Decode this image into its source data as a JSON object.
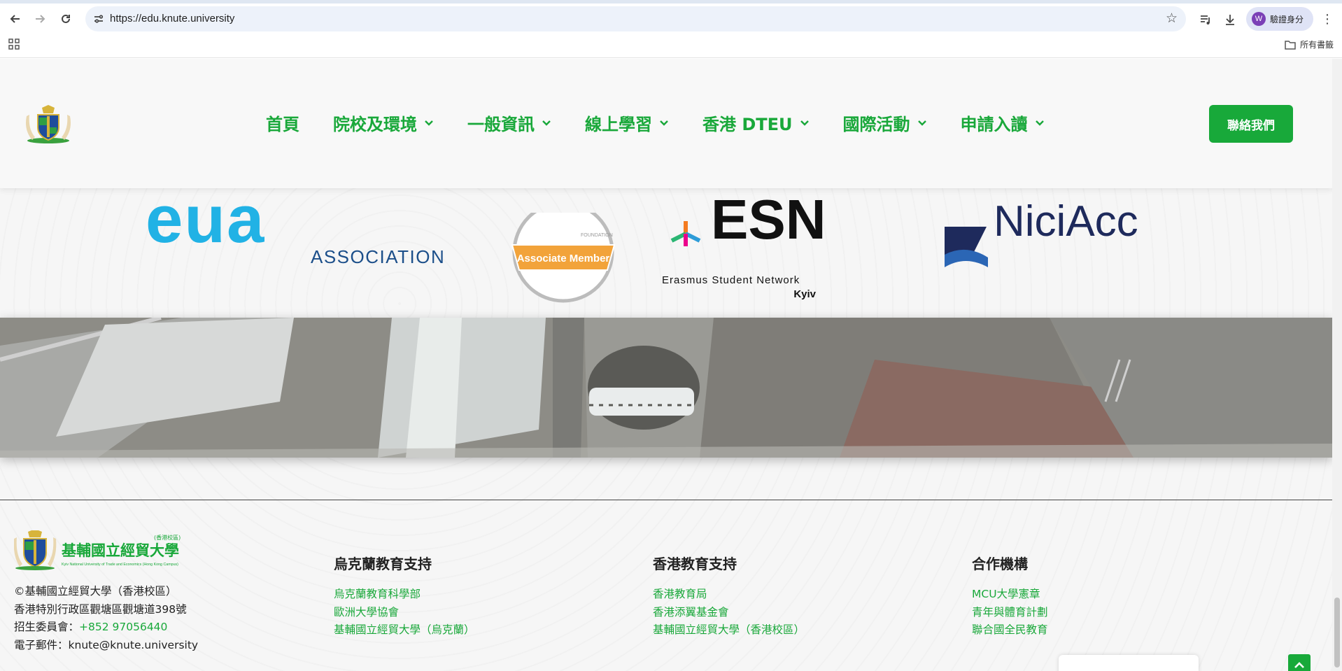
{
  "browser": {
    "url": "https://edu.knute.university",
    "profile_label": "驗證身分",
    "profile_initial": "W",
    "bookmarks_all": "所有書籤"
  },
  "header": {
    "nav": [
      {
        "label": "首頁",
        "dropdown": false
      },
      {
        "label": "院校及環境",
        "dropdown": true
      },
      {
        "label": "一般資訊",
        "dropdown": true
      },
      {
        "label": "線上學習",
        "dropdown": true
      },
      {
        "label": "香港 DTEU",
        "dropdown": true
      },
      {
        "label": "國際活動",
        "dropdown": true
      },
      {
        "label": "申請入讀",
        "dropdown": true
      }
    ],
    "cta_label": "聯絡我們"
  },
  "partners": {
    "edu_word": "eua",
    "edu_sub": "ASSOCIATION",
    "egf_badge": "Associate Member",
    "egf_foundation": "FOUNDATION",
    "esn_word": "ESN",
    "esn_sub": "Erasmus Student Network",
    "esn_city": "Kyiv",
    "nq_word": "NiciAcc"
  },
  "footer": {
    "logo_name": "基輔國立經貿大學",
    "logo_campus": "(香港校區)",
    "logo_en": "Kyiv National University of Trade and Economics (Hong Kong Campus)",
    "copyright": "©基輔國立經貿大學（香港校區）",
    "address": "香港特別行政區觀塘區觀塘道398號",
    "admission_label": "招生委員會：",
    "admission_phone": "+852 97056440",
    "email_label": "電子郵件：",
    "email": "knute@knute.university",
    "columns": [
      {
        "title": "烏克蘭教育支持",
        "links": [
          "烏克蘭教育科學部",
          "歐洲大學協會",
          "基輔國立經貿大學（烏克蘭）"
        ]
      },
      {
        "title": "香港教育支持",
        "links": [
          "香港教育局",
          "香港添翼基金會",
          "基輔國立經貿大學（香港校區）"
        ]
      },
      {
        "title": "合作機構",
        "links": [
          "MCU大學憲章",
          "青年與體育計劃",
          "聯合國全民教育"
        ]
      }
    ]
  },
  "colors": {
    "brand_green": "#19a83a",
    "cta_green": "#18a93a"
  }
}
